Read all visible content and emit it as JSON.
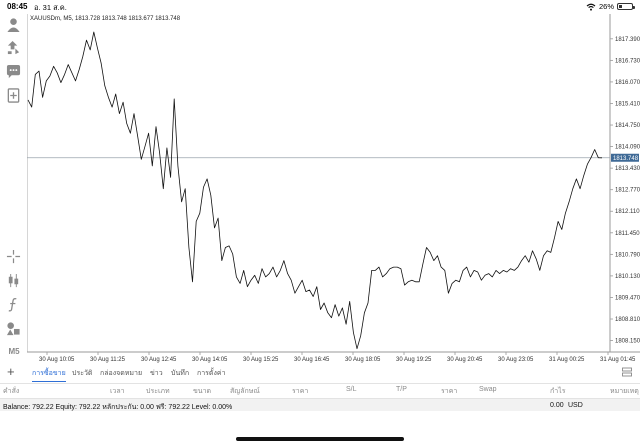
{
  "status_bar": {
    "time": "08:45",
    "date": "อ. 31 ส.ค.",
    "battery": "26%",
    "battery_level": 0.26
  },
  "toolbar": {
    "icons": [
      "account-icon",
      "trade-icon",
      "chat-icon",
      "add-document-icon",
      "crosshair-icon",
      "indicators-icon",
      "function-icon",
      "objects-icon"
    ],
    "timeframe": "M5"
  },
  "chart": {
    "symbol_info": "XAUUSDm, M5, 1813.728 1813.748 1813.677 1813.748",
    "current_price": "1813.748",
    "colors": {
      "line": "#111111",
      "current_price_line": "#9aa3ad",
      "current_price_badge": "#3f6a96",
      "axis": "#c8c8c8"
    }
  },
  "chart_data": {
    "type": "line",
    "series": [
      {
        "values": [
          1815.52,
          1815.3,
          1816.3,
          1816.4,
          1815.6,
          1816.1,
          1816.25,
          1816.55,
          1816.35,
          1816.05,
          1816.3,
          1816.6,
          1816.35,
          1816.1,
          1816.45,
          1816.85,
          1817.35,
          1817.05,
          1817.6,
          1817.1,
          1816.65,
          1815.95,
          1815.6,
          1815.3,
          1815.7,
          1815.1,
          1815.45,
          1814.8,
          1814.5,
          1815.1,
          1814.4,
          1813.7,
          1814.1,
          1814.5,
          1813.5,
          1814.7,
          1813.9,
          1812.8,
          1814.05,
          1813.15,
          1815.55,
          1813.5,
          1812.4,
          1812.8,
          1811.0,
          1809.95,
          1811.8,
          1812.05,
          1812.85,
          1813.1,
          1812.6,
          1811.6,
          1811.9,
          1810.6,
          1811.0,
          1811.05,
          1810.8,
          1810.1,
          1809.9,
          1810.3,
          1809.8,
          1810.0,
          1810.15,
          1809.9,
          1810.35,
          1810.1,
          1810.2,
          1810.4,
          1810.1,
          1810.3,
          1810.6,
          1810.2,
          1810.0,
          1809.6,
          1809.8,
          1810.0,
          1809.65,
          1809.7,
          1809.5,
          1809.8,
          1809.1,
          1809.3,
          1809.0,
          1808.85,
          1809.25,
          1808.9,
          1809.15,
          1808.65,
          1809.35,
          1808.4,
          1807.9,
          1808.3,
          1809.0,
          1809.3,
          1810.3,
          1810.3,
          1810.4,
          1810.1,
          1810.2,
          1810.35,
          1810.4,
          1810.4,
          1810.35,
          1809.85,
          1809.95,
          1810.0,
          1809.95,
          1809.95,
          1810.5,
          1811.0,
          1810.85,
          1810.6,
          1810.75,
          1810.4,
          1810.3,
          1809.6,
          1809.9,
          1810.0,
          1809.95,
          1810.3,
          1810.4,
          1810.1,
          1810.3,
          1810.25,
          1810.0,
          1810.15,
          1810.2,
          1810.1,
          1810.3,
          1810.2,
          1810.3,
          1810.25,
          1810.35,
          1810.3,
          1810.4,
          1810.6,
          1810.75,
          1810.55,
          1810.9,
          1810.65,
          1810.3,
          1810.75,
          1810.9,
          1810.85,
          1811.3,
          1811.8,
          1811.55,
          1812.05,
          1812.4,
          1812.8,
          1813.1,
          1812.8,
          1813.2,
          1813.55,
          1813.75,
          1814.0,
          1813.75,
          1813.748
        ]
      }
    ],
    "y_ticks": [
      "1817.390",
      "1816.730",
      "1816.070",
      "1815.410",
      "1814.750",
      "1814.090",
      "1813.430",
      "1812.770",
      "1812.110",
      "1811.450",
      "1810.790",
      "1810.130",
      "1809.470",
      "1808.810",
      "1808.150"
    ],
    "x_ticks": [
      "30 Aug 10:05",
      "30 Aug 11:25",
      "30 Aug 12:45",
      "30 Aug 14:05",
      "30 Aug 15:25",
      "30 Aug 16:45",
      "30 Aug 18:05",
      "30 Aug 19:25",
      "30 Aug 20:45",
      "30 Aug 23:05",
      "31 Aug 00:25",
      "31 Aug 01:45"
    ],
    "ylim": [
      1807.8,
      1818.15
    ],
    "grid": false
  },
  "tabs": {
    "items": [
      "การซื้อขาย",
      "ประวัติ",
      "กล่องจดหมาย",
      "ข่าว",
      "บันทึก",
      "การตั้งค่า"
    ],
    "active": "การซื้อขาย"
  },
  "columns": [
    "คำสั่ง",
    "เวลา",
    "ประเภท",
    "ขนาด",
    "สัญลักษณ์",
    "ราคา",
    "S/L",
    "T/P",
    "ราคา",
    "Swap",
    "กำไร",
    "หมายเหตุ"
  ],
  "balance": {
    "text": "Balance: 792.22 Equity: 792.22 หลักประกัน: 0.00 ฟรี: 792.22 Level: 0.00%",
    "profit": "0.00",
    "currency": "USD"
  }
}
